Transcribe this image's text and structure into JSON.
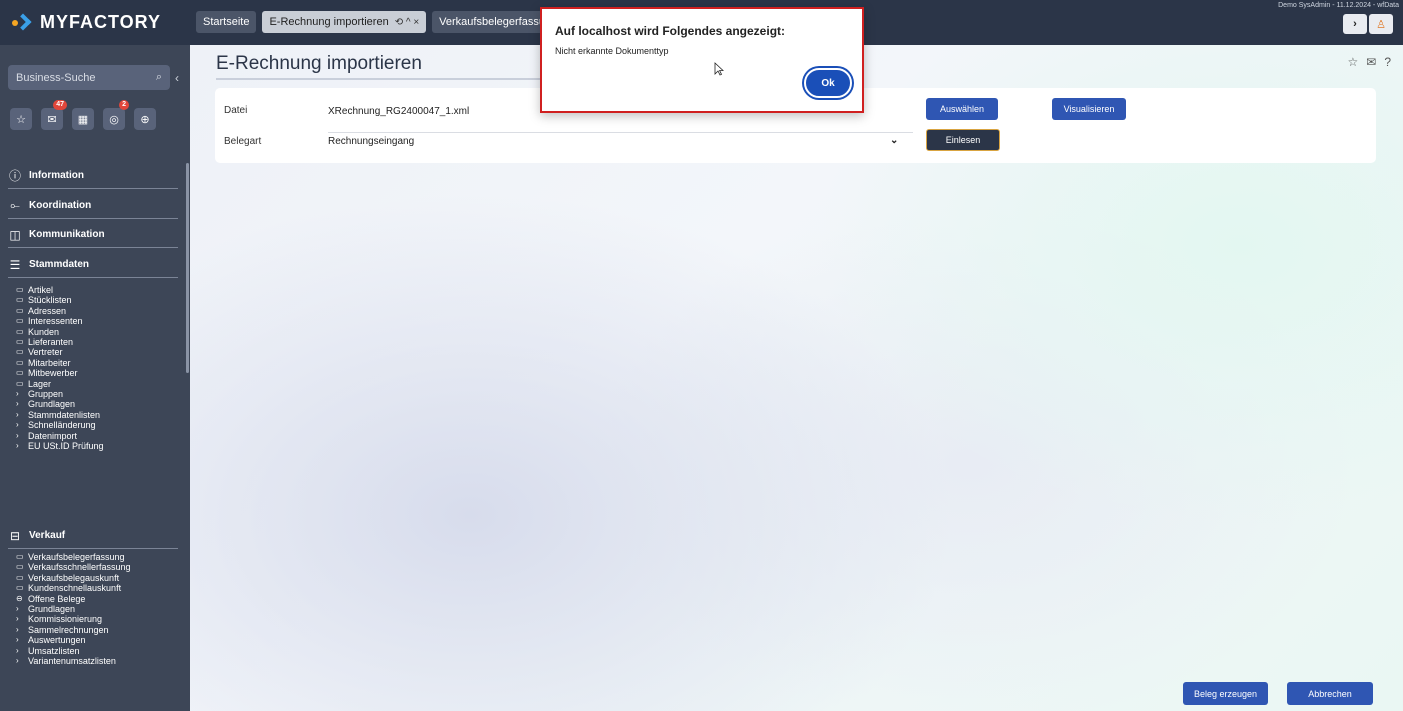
{
  "app": {
    "brand": "MYFACTORY",
    "user_info": "Demo SysAdmin - 11.12.2024 - wfData"
  },
  "tabs": [
    {
      "label": "Startseite",
      "active": false
    },
    {
      "label": "E-Rechnung importieren",
      "active": true,
      "controls": "⟲ ^ ×"
    },
    {
      "label": "Verkaufsbelegerfassu",
      "active": false
    }
  ],
  "sidebar": {
    "search_placeholder": "Business-Suche",
    "quick_buttons": [
      {
        "icon": "star-icon",
        "glyph": "☆",
        "badge": ""
      },
      {
        "icon": "mail-icon",
        "glyph": "✉",
        "badge": "47"
      },
      {
        "icon": "calendar-icon",
        "glyph": "▦",
        "badge": ""
      },
      {
        "icon": "task-icon",
        "glyph": "◎",
        "badge": "2"
      },
      {
        "icon": "add-icon",
        "glyph": "⊕",
        "badge": ""
      }
    ],
    "sections": [
      {
        "label": "Information",
        "icon": "info-icon",
        "glyph": "ⓘ"
      },
      {
        "label": "Koordination",
        "icon": "coordination-icon",
        "glyph": "⟜"
      },
      {
        "label": "Kommunikation",
        "icon": "chat-icon",
        "glyph": "◫"
      },
      {
        "label": "Stammdaten",
        "icon": "database-icon",
        "glyph": "☰"
      },
      {
        "label": "Verkauf",
        "icon": "sales-icon",
        "glyph": "⊟"
      }
    ],
    "stammdaten_items": [
      {
        "label": "Artikel",
        "icon": "▭"
      },
      {
        "label": "Stücklisten",
        "icon": "▭"
      },
      {
        "label": "Adressen",
        "icon": "▭"
      },
      {
        "label": "Interessenten",
        "icon": "▭"
      },
      {
        "label": "Kunden",
        "icon": "▭"
      },
      {
        "label": "Lieferanten",
        "icon": "▭"
      },
      {
        "label": "Vertreter",
        "icon": "▭"
      },
      {
        "label": "Mitarbeiter",
        "icon": "▭"
      },
      {
        "label": "Mitbewerber",
        "icon": "▭"
      },
      {
        "label": "Lager",
        "icon": "▭"
      },
      {
        "label": "Gruppen",
        "icon": "›"
      },
      {
        "label": "Grundlagen",
        "icon": "›"
      },
      {
        "label": "Stammdatenlisten",
        "icon": "›"
      },
      {
        "label": "Schnelländerung",
        "icon": "›"
      },
      {
        "label": "Datenimport",
        "icon": "›"
      },
      {
        "label": "EU USt.ID Prüfung",
        "icon": "›"
      }
    ],
    "verkauf_items": [
      {
        "label": "Verkaufsbelegerfassung",
        "icon": "▭"
      },
      {
        "label": "Verkaufsschnellerfassung",
        "icon": "▭"
      },
      {
        "label": "Verkaufsbelegauskunft",
        "icon": "▭"
      },
      {
        "label": "Kundenschnellauskunft",
        "icon": "▭"
      },
      {
        "label": "Offene Belege",
        "icon": "⊖"
      },
      {
        "label": "Grundlagen",
        "icon": "›"
      },
      {
        "label": "Kommissionierung",
        "icon": "›"
      },
      {
        "label": "Sammelrechnungen",
        "icon": "›"
      },
      {
        "label": "Auswertungen",
        "icon": "›"
      },
      {
        "label": "Umsatzlisten",
        "icon": "›"
      },
      {
        "label": "Variantenumsatzlisten",
        "icon": "›"
      }
    ]
  },
  "main": {
    "title": "E-Rechnung importieren",
    "form": {
      "datei_label": "Datei",
      "datei_value": "XRechnung_RG2400047_1.xml",
      "belegart_label": "Belegart",
      "belegart_value": "Rechnungseingang",
      "auswaehlen_label": "Auswählen",
      "visualisieren_label": "Visualisieren",
      "einlesen_label": "Einlesen"
    },
    "footer": {
      "beleg_erzeugen_label": "Beleg erzeugen",
      "abbrechen_label": "Abbrechen"
    }
  },
  "dialog": {
    "title": "Auf localhost wird Folgendes angezeigt:",
    "message": "Nicht erkannte Dokumenttyp",
    "ok_label": "Ok"
  },
  "colors": {
    "sidebar_bg": "#3d4657",
    "topbar_bg": "#2b3548",
    "primary_button": "#2f56b3",
    "accent": "#d9a441",
    "dialog_border": "#d02020"
  }
}
